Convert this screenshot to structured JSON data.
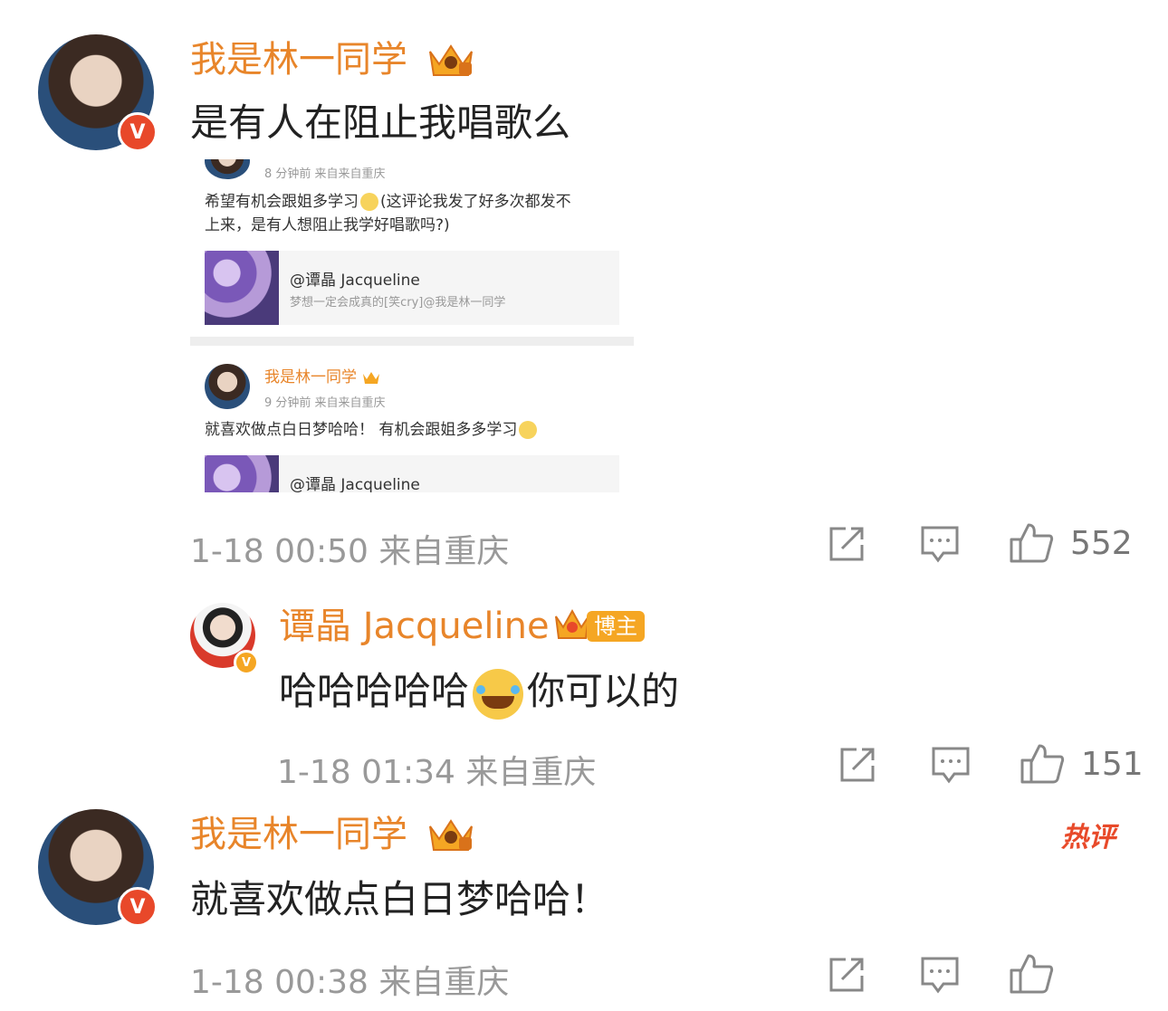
{
  "comments": [
    {
      "user": "我是林一同学",
      "text": "是有人在阻止我唱歌么",
      "time": "1-18 00:50",
      "location": "来自重庆",
      "likes": "552",
      "embedded_screenshot": {
        "post1": {
          "time": "8 分钟前",
          "source": "来自来自重庆",
          "text_line1": "希望有机会跟姐多学习",
          "text_line1_tail": "(这评论我发了好多次都发不",
          "text_line2": "上来，是有人想阻止我学好唱歌吗?)",
          "card_title": "@谭晶 Jacqueline",
          "card_sub": "梦想一定会成真的[笑cry]@我是林一同学"
        },
        "post2": {
          "user": "我是林一同学",
          "time": "9 分钟前",
          "source": "来自来自重庆",
          "text": "就喜欢做点白日梦哈哈！ 有机会跟姐多多学习",
          "card_title": "@谭晶 Jacqueline"
        }
      }
    },
    {
      "user": "谭晶 Jacqueline",
      "tag": "博主",
      "text_before": "哈哈哈哈哈",
      "text_after": "你可以的",
      "time": "1-18 01:34",
      "location": "来自重庆",
      "likes": "151"
    },
    {
      "user": "我是林一同学",
      "badge": "热评",
      "text": "就喜欢做点白日梦哈哈！",
      "time": "1-18 00:38",
      "location": "来自重庆"
    }
  ],
  "colors": {
    "name": "#e8852a",
    "meta": "#999999",
    "hot": "#e84a2a",
    "vip": "#f5a623"
  }
}
